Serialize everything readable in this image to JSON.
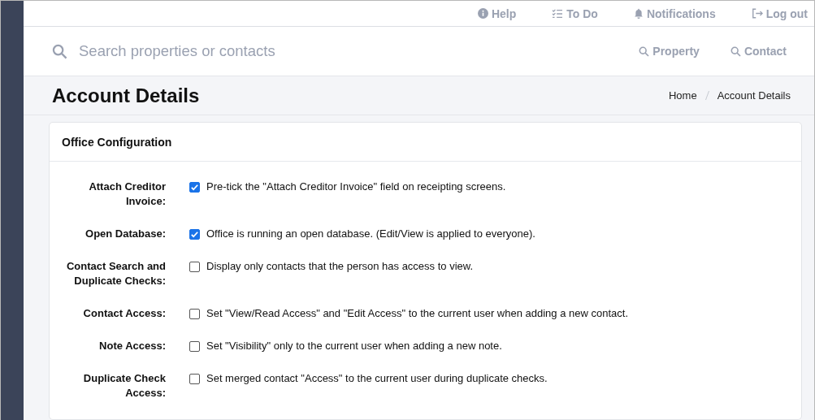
{
  "top_nav": [
    "Help",
    "To Do",
    "Notifications",
    "Log out"
  ],
  "search": {
    "placeholder": "Search properties or contacts",
    "buttons": [
      "Property",
      "Contact"
    ]
  },
  "page": {
    "title": "Account Details",
    "breadcrumb": [
      "Home",
      "Account Details"
    ]
  },
  "card": {
    "title": "Office Configuration",
    "settings": [
      {
        "label": "Attach Creditor Invoice:",
        "checked": true,
        "description": "Pre-tick the \"Attach Creditor Invoice\" field on receipting screens."
      },
      {
        "label": "Open Database:",
        "checked": true,
        "description": "Office is running an open database. (Edit/View is applied to everyone)."
      },
      {
        "label": "Contact Search and Duplicate Checks:",
        "checked": false,
        "description": "Display only contacts that the person has access to view."
      },
      {
        "label": "Contact Access:",
        "checked": false,
        "description": "Set \"View/Read Access\" and \"Edit Access\" to the current user when adding a new contact."
      },
      {
        "label": "Note Access:",
        "checked": false,
        "description": "Set \"Visibility\" only to the current user when adding a new note."
      },
      {
        "label": "Duplicate Check Access:",
        "checked": false,
        "description": "Set merged contact \"Access\" to the current user during duplicate checks."
      }
    ]
  }
}
